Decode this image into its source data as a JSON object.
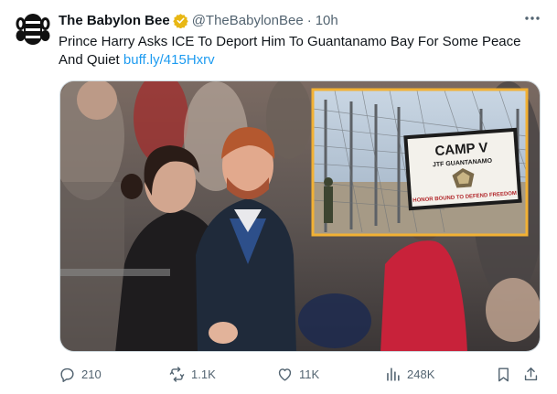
{
  "author": {
    "name": "The Babylon Bee",
    "handle": "@TheBabylonBee",
    "dot": "·",
    "time": "10h",
    "verified_color": "#e8b714"
  },
  "tweet": {
    "text": "Prince Harry Asks ICE To Deport Him To Guantanamo Bay For Some Peace And Quiet ",
    "link": "buff.ly/415Hxrv",
    "link_color": "#1d9bf0"
  },
  "media": {
    "inset_sign_title": "CAMP V",
    "inset_sign_subtitle": "JTF GUANTANAMO",
    "inset_sign_motto": "HONOR BOUND TO DEFEND FREEDOM",
    "inset_border_color": "#f2b134"
  },
  "actions": {
    "replies": "210",
    "reposts": "1.1K",
    "likes": "11K",
    "views": "248K"
  },
  "icons": [
    "babylon-bee-logo",
    "verified-badge-icon",
    "more-icon",
    "reply-icon",
    "repost-icon",
    "like-icon",
    "views-icon",
    "bookmark-icon",
    "share-icon"
  ]
}
